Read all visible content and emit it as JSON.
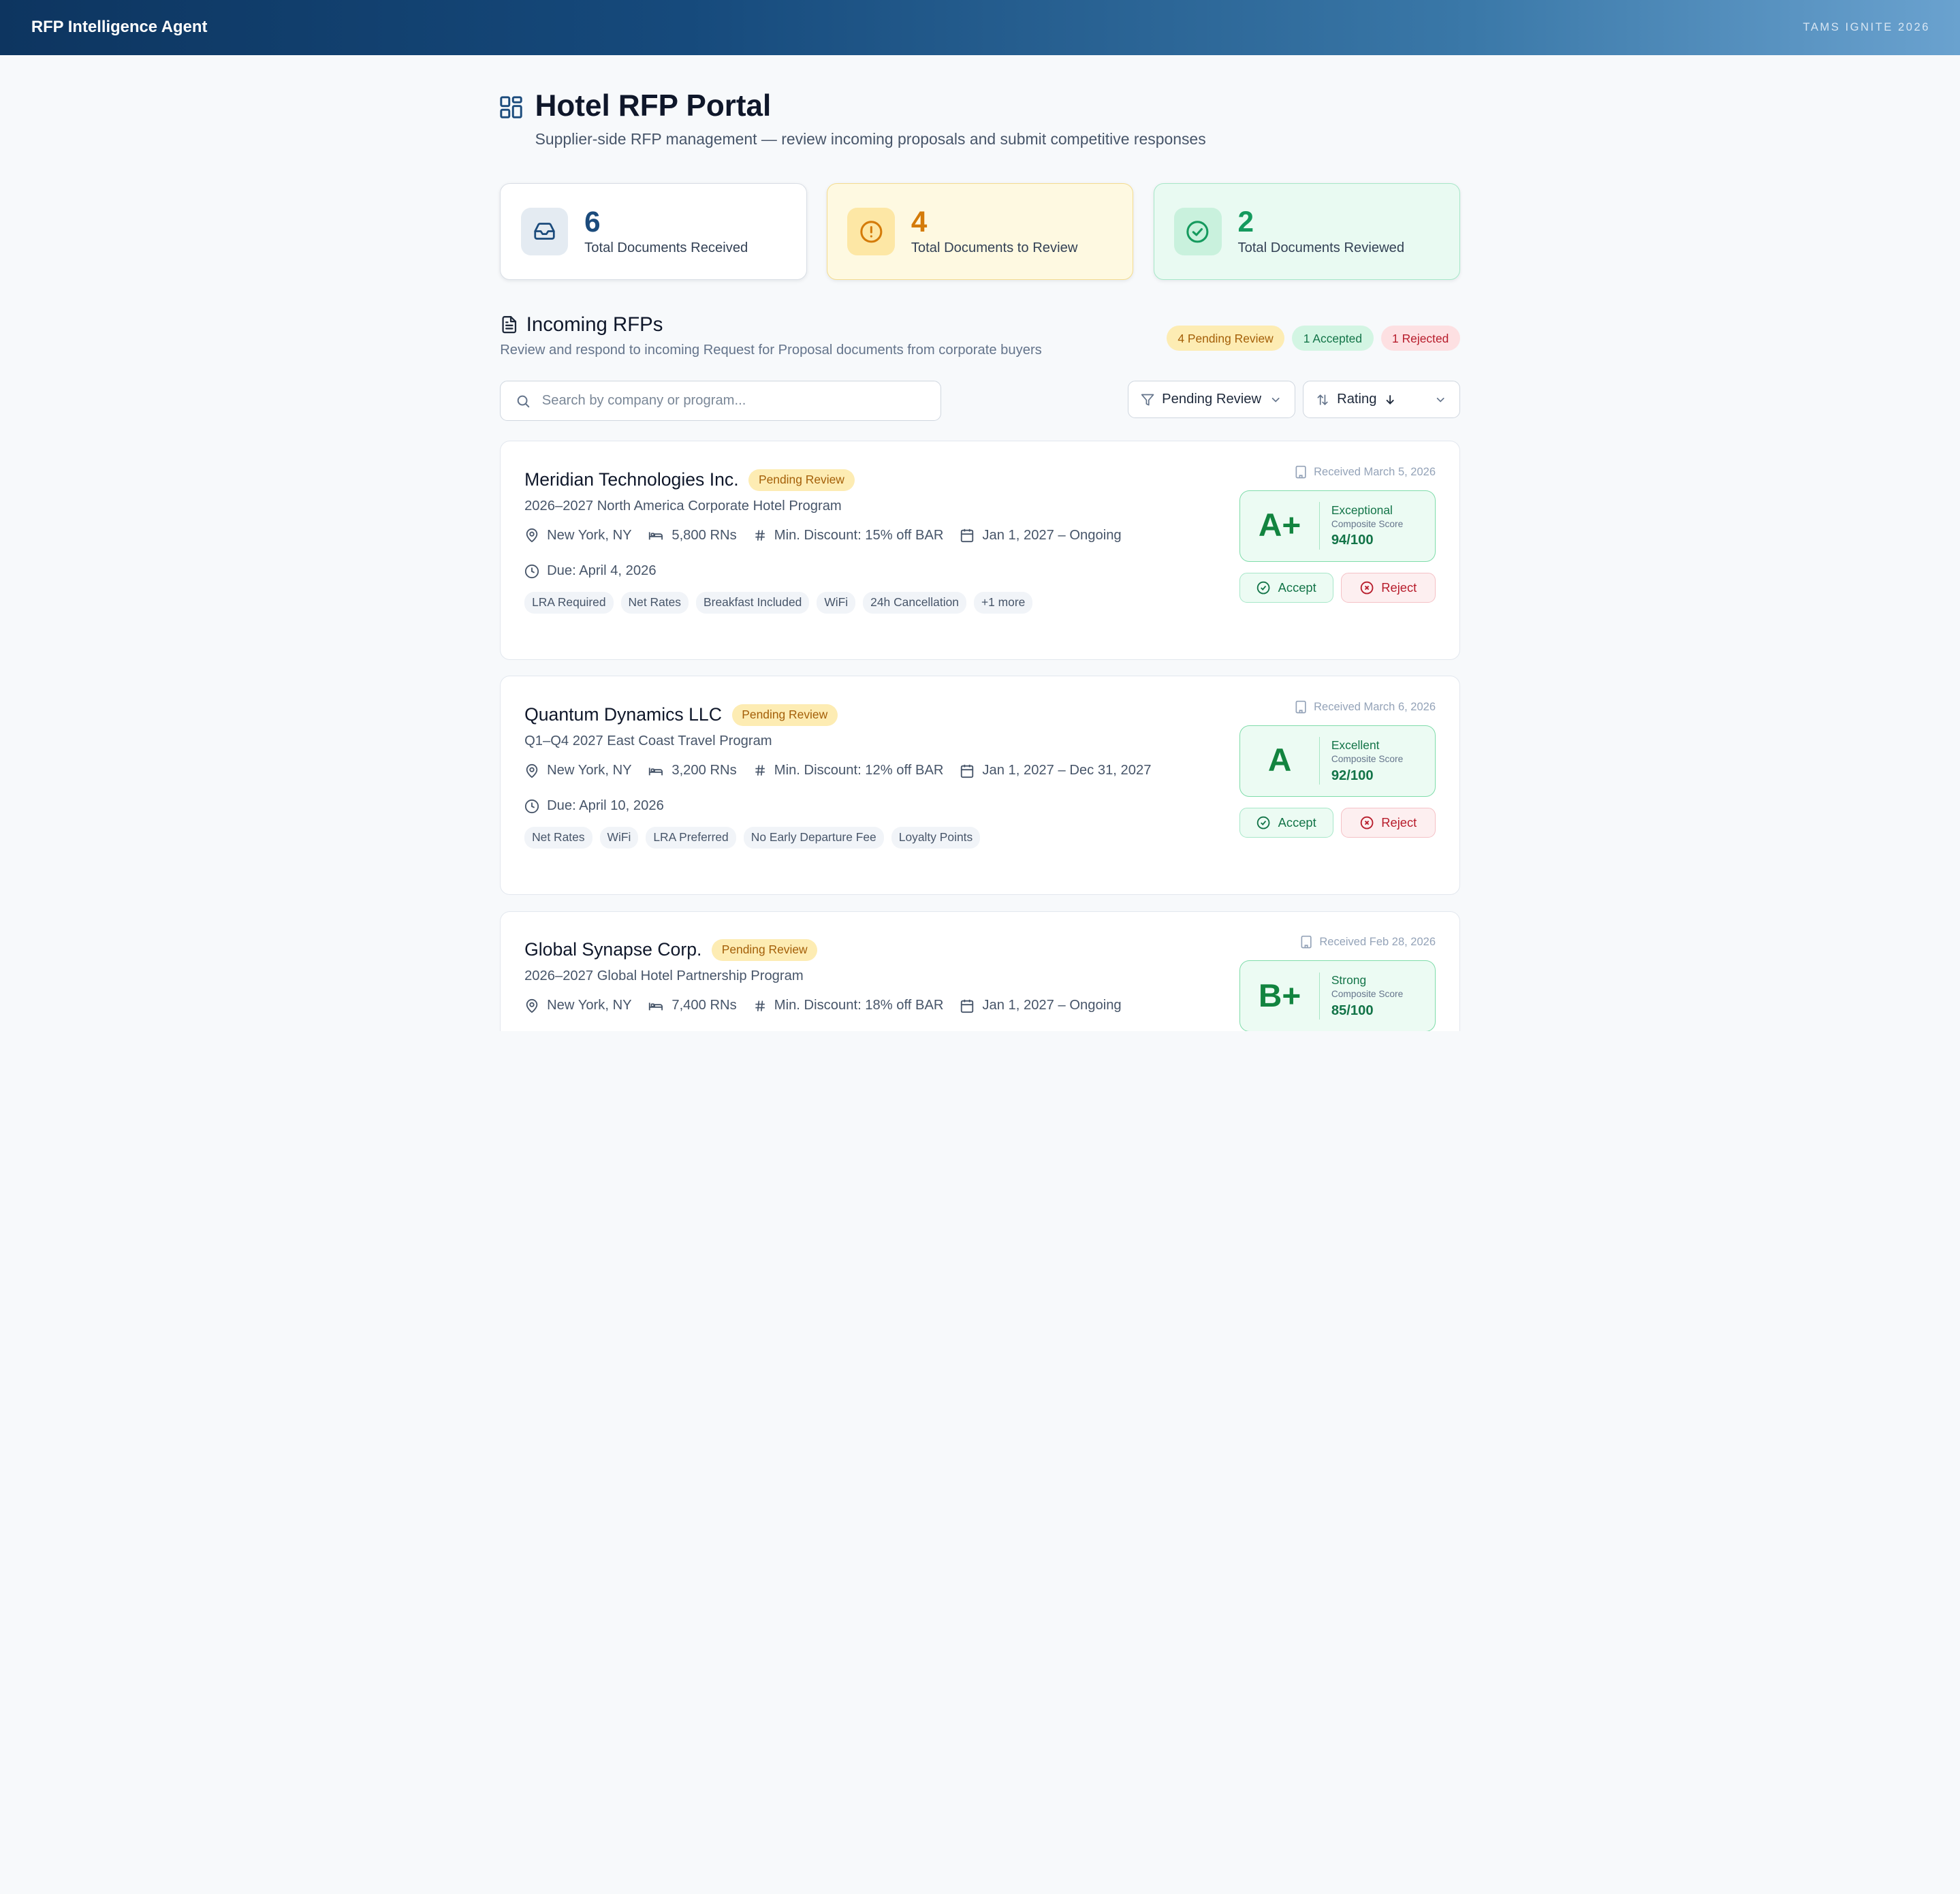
{
  "app": {
    "title": "RFP Intelligence Agent",
    "event": "TAMS IGNITE 2026"
  },
  "header": {
    "title": "Hotel RFP Portal",
    "subtitle": "Supplier-side RFP management — review incoming proposals and submit competitive responses",
    "icon": "dashboard-grid-icon"
  },
  "stats": [
    {
      "value": "6",
      "label": "Total Documents Received",
      "icon": "inbox-icon"
    },
    {
      "value": "4",
      "label": "Total Documents to Review",
      "icon": "alert-circle-icon"
    },
    {
      "value": "2",
      "label": "Total Documents Reviewed",
      "icon": "check-circle-icon"
    }
  ],
  "section": {
    "title": "Incoming RFPs",
    "description": "Review and respond to incoming Request for Proposal documents from corporate buyers",
    "badges": {
      "pending": "4 Pending Review",
      "accepted": "1 Accepted",
      "rejected": "1 Rejected"
    }
  },
  "toolbar": {
    "search_placeholder": "Search by company or program...",
    "filter_value": "Pending Review",
    "sort_value": "Rating"
  },
  "colors": {
    "accent": "#164a7c",
    "pending": "#fdecb3",
    "accepted": "#d3f5e3",
    "rejected": "#fde0e2"
  },
  "rfps": [
    {
      "company": "Meridian Technologies Inc.",
      "status": "Pending Review",
      "program": "2026–2027 North America Corporate Hotel Program",
      "location": "New York, NY",
      "rns": "5,800 RNs",
      "discount": "Min. Discount: 15% off BAR",
      "period": "Jan 1, 2027 – Ongoing",
      "due": "Due: April 4, 2026",
      "tags": [
        "LRA Required",
        "Net Rates",
        "Breakfast Included",
        "WiFi",
        "24h Cancellation",
        "+1 more"
      ],
      "received": "Received March 5, 2026",
      "grade": "A+",
      "level": "Exceptional",
      "score_label": "Composite Score",
      "score": "94/100",
      "accept": "Accept",
      "reject": "Reject"
    },
    {
      "company": "Quantum Dynamics LLC",
      "status": "Pending Review",
      "program": "Q1–Q4 2027 East Coast Travel Program",
      "location": "New York, NY",
      "rns": "3,200 RNs",
      "discount": "Min. Discount: 12% off BAR",
      "period": "Jan 1, 2027 – Dec 31, 2027",
      "due": "Due: April 10, 2026",
      "tags": [
        "Net Rates",
        "WiFi",
        "LRA Preferred",
        "No Early Departure Fee",
        "Loyalty Points"
      ],
      "received": "Received March 6, 2026",
      "grade": "A",
      "level": "Excellent",
      "score_label": "Composite Score",
      "score": "92/100",
      "accept": "Accept",
      "reject": "Reject"
    },
    {
      "company": "Global Synapse Corp.",
      "status": "Pending Review",
      "program": "2026–2027 Global Hotel Partnership Program",
      "location": "New York, NY",
      "rns": "7,400 RNs",
      "discount": "Min. Discount: 18% off BAR",
      "period": "Jan 1, 2027 – Ongoing",
      "received": "Received Feb 28, 2026",
      "grade": "B+",
      "level": "Strong",
      "score_label": "Composite Score",
      "score": "85/100"
    }
  ]
}
